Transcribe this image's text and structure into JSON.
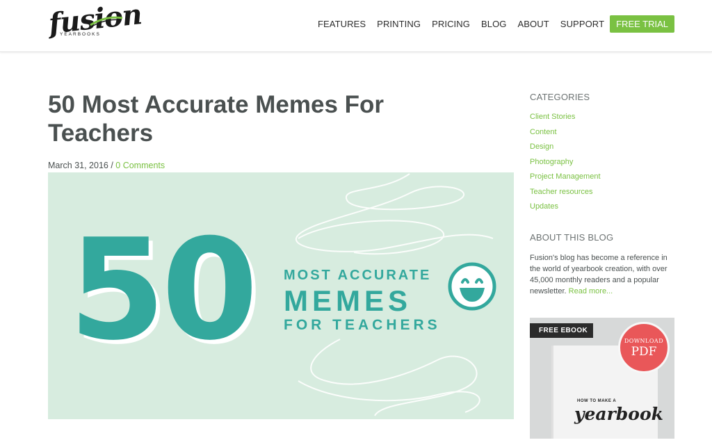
{
  "logo": {
    "script": "fusion",
    "sub": "YEARBOOKS"
  },
  "nav": {
    "items": [
      "FEATURES",
      "PRINTING",
      "PRICING",
      "BLOG",
      "ABOUT",
      "SUPPORT"
    ],
    "cta": "FREE TRIAL"
  },
  "article": {
    "title": "50 Most Accurate Memes For Teachers",
    "date": "March 31, 2016",
    "separator": " / ",
    "comments": "0 Comments",
    "hero": {
      "big_number": "50",
      "line1": "MOST ACCURATE",
      "line2": "MEMES",
      "line3": "FOR TEACHERS",
      "icon": "smiley-face-icon"
    }
  },
  "sidebar": {
    "categories_heading": "CATEGORIES",
    "categories": [
      "Client Stories",
      "Content",
      "Design",
      "Photography",
      "Project Management",
      "Teacher resources",
      "Updates"
    ],
    "about_heading": "ABOUT THIS BLOG",
    "about_text": "Fusion's blog has become a reference in the world of yearbook creation, with over 45,000 monthly readers and a popular newsletter. ",
    "about_link": "Read more...",
    "ebook": {
      "badge": "FREE EBOOK",
      "stamp_top": "DOWNLOAD",
      "stamp_bottom": "PDF",
      "book_howto": "HOW TO MAKE A",
      "book_title": "yearbook"
    }
  },
  "colors": {
    "accent": "#7ac142",
    "teal": "#33a89d",
    "hero_bg": "#d7ecdf",
    "text": "#4a5050",
    "stamp": "#e95759"
  }
}
